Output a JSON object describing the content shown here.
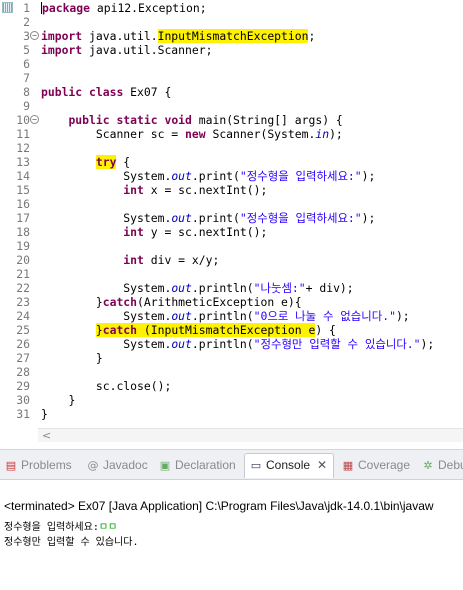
{
  "editor": {
    "line_numbers": [
      "1",
      "2",
      "3",
      "5",
      "6",
      "7",
      "8",
      "9",
      "10",
      "11",
      "12",
      "13",
      "14",
      "15",
      "16",
      "17",
      "18",
      "19",
      "20",
      "21",
      "22",
      "23",
      "24",
      "25",
      "26",
      "27",
      "28",
      "29",
      "30",
      "31"
    ],
    "code": {
      "package_kw": "package",
      "package_name": " api12.Exception;",
      "import_kw": "import",
      "import1_pre": " java.util.",
      "import1_hl": "InputMismatchException",
      "import1_post": ";",
      "import2_rest": " java.util.Scanner;",
      "public_kw": "public",
      "class_kw": "class",
      "class_name": " Ex07 {",
      "static_kw": "static",
      "void_kw": "void",
      "main_sig": " main(String[] args) {",
      "scanner_decl": "Scanner sc = ",
      "new_kw": "new",
      "scanner_ctor_pre": " Scanner(System.",
      "in_field": "in",
      "scanner_ctor_post": ");",
      "try_kw": "try",
      "try_brace": " {",
      "system_dot": "System.",
      "out_field": "out",
      "print_call": ".print(",
      "println_call": ".println(",
      "prompt_str": "\"정수형을 입력하세요:\"",
      "close_paren_semi": ");",
      "int_kw": "int",
      "x_decl": " x = sc.nextInt();",
      "y_decl": " y = sc.nextInt();",
      "div_decl": " div = x/y;",
      "div_str": "\"나눗셈:\"",
      "div_concat": "+ div);",
      "catch1_pre": "}",
      "catch_kw": "catch",
      "catch1_rest": "(ArithmeticException e){",
      "zero_str": "\"0으로 나눌 수 없습니다.\"",
      "catch2_hl_post": " (InputMismatchException e",
      "catch2_post": ") {",
      "int_only_str": "\"정수형만 입력할 수 있습니다.\"",
      "close_brace": "}",
      "close_stmt": "sc.close();"
    }
  },
  "tabs": [
    {
      "label": "Problems",
      "icon": "problems-icon"
    },
    {
      "label": "Javadoc",
      "icon": "javadoc-icon"
    },
    {
      "label": "Declaration",
      "icon": "declaration-icon"
    },
    {
      "label": "Console",
      "icon": "console-icon",
      "active": true
    },
    {
      "label": "Coverage",
      "icon": "coverage-icon"
    },
    {
      "label": "Debu",
      "icon": "debug-icon"
    }
  ],
  "console": {
    "terminated": "<terminated> Ex07 [Java Application] C:\\Program Files\\Java\\jdk-14.0.1\\bin\\javaw",
    "prompt_out": "정수형을 입력하세요:",
    "user_input": "ㅁㅁ",
    "result_out": "정수형만 입력할 수 있습니다."
  },
  "colors": {
    "keyword": "#7f0055",
    "string": "#2a00ff",
    "field": "#0000c0",
    "highlight": "#fff200",
    "console_input": "#00a000"
  }
}
